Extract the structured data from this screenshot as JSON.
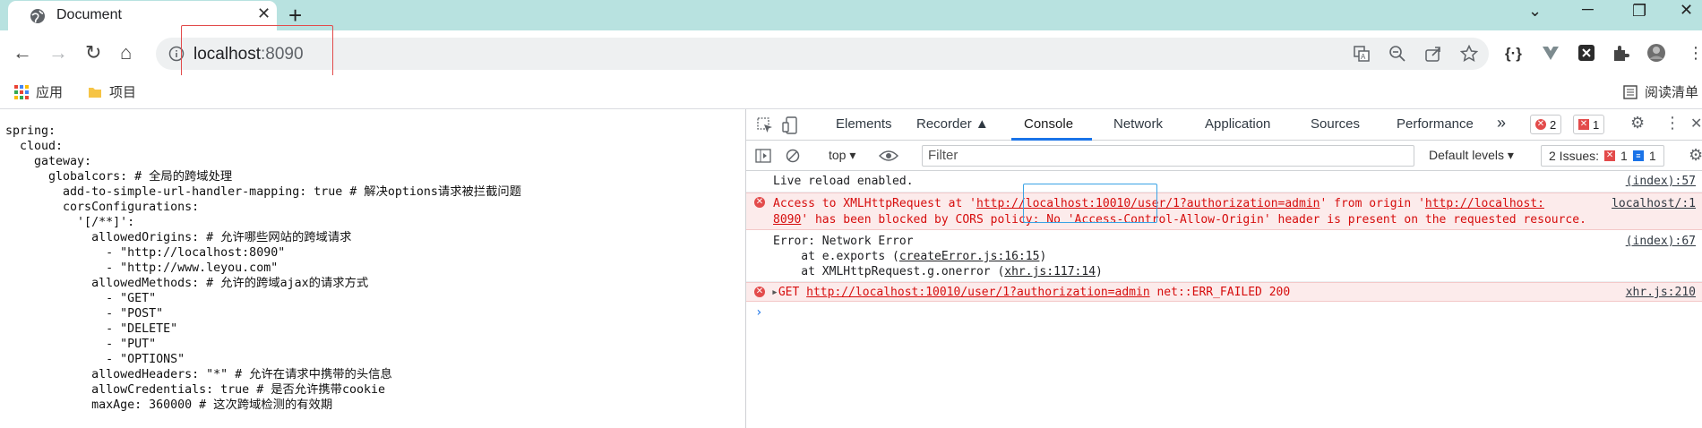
{
  "browser": {
    "tab_title": "Document",
    "url_host": "localhost",
    "url_port": ":8090",
    "accent": "#1a73e8",
    "tabstrip_color": "#b8e2e0"
  },
  "bookmarks": {
    "apps": "应用",
    "folder": "项目",
    "reading_list": "阅读清单"
  },
  "page": {
    "yaml": "spring:\n  cloud:\n    gateway:\n      globalcors: # 全局的跨域处理\n        add-to-simple-url-handler-mapping: true # 解决options请求被拦截问题\n        corsConfigurations:\n          '[/**]':\n            allowedOrigins: # 允许哪些网站的跨域请求\n              - \"http://localhost:8090\"\n              - \"http://www.leyou.com\"\n            allowedMethods: # 允许的跨域ajax的请求方式\n              - \"GET\"\n              - \"POST\"\n              - \"DELETE\"\n              - \"PUT\"\n              - \"OPTIONS\"\n            allowedHeaders: \"*\" # 允许在请求中携带的头信息\n            allowCredentials: true # 是否允许携带cookie\n            maxAge: 360000 # 这次跨域检测的有效期"
  },
  "devtools": {
    "tabs": [
      "Elements",
      "Recorder",
      "Console",
      "Network",
      "Application",
      "Sources",
      "Performance"
    ],
    "error_count": "2",
    "issue_count": "1",
    "context": "top",
    "filter_placeholder": "Filter",
    "levels": "Default levels",
    "issues_label": "2 Issues:",
    "issues_err": "1",
    "issues_info": "1"
  },
  "console": {
    "m1_text": "Live reload enabled.",
    "m1_src": "(index):57",
    "m2_pre": "Access to XMLHttpRequest at '",
    "m2_link": "http://localhost:10010/user/1?authorization=admin",
    "m2_mid": "' from origin '",
    "m2_origin": "http://localhost:",
    "m2_line2_link": "8090",
    "m2_line2": "' has been blocked by CORS policy: No 'Access-Control-Allow-Origin' header is present on the requested resource.",
    "m2_src": "localhost/:1",
    "m3_line1": "Error: Network Error",
    "m3_line2_pre": "    at e.exports (",
    "m3_line2_link": "createError.js:16:15",
    "m3_line2_post": ")",
    "m3_line3_pre": "    at XMLHttpRequest.g.onerror (",
    "m3_line3_link": "xhr.js:117:14",
    "m3_line3_post": ")",
    "m3_src": "(index):67",
    "m4_pre": "GET ",
    "m4_link": "http://localhost:10010/user/1?authorization=admin",
    "m4_post": " net::ERR_FAILED 200",
    "m4_src": "xhr.js:210"
  }
}
